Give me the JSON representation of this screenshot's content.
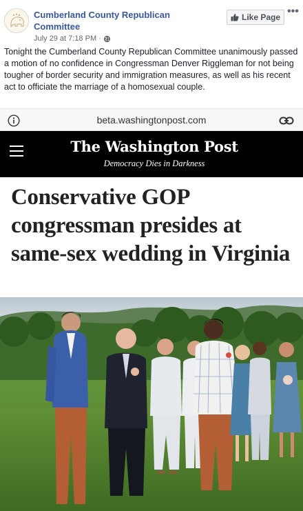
{
  "post": {
    "page_name": "Cumberland County Republican Committee",
    "timestamp": "July 29 at 7:18 PM",
    "separator": "·",
    "privacy_icon": "globe-icon",
    "like_page_label": "Like Page",
    "like_icon": "thumbs-up-icon",
    "more_label": "•••",
    "text": "Tonight the Cumberland County Republican Committee unanimously passed a motion of no confidence in Congressman Denver Riggleman for not being tougher of border security and immigration measures, as well as his recent act to officiate the marriage of a homosexual couple."
  },
  "link_preview": {
    "url": "beta.washingtonpost.com",
    "info_icon": "info-icon",
    "link_icon": "link-icon",
    "masthead": "The Washington Post",
    "tagline": "Democracy Dies in Darkness",
    "menu_icon": "hamburger-icon",
    "headline": "Conservative GOP congressman presides at same-sex wedding in Virginia",
    "photo": "outdoor-wedding-photo"
  },
  "colors": {
    "facebook_link": "#385898",
    "wapo_banner": "#000000",
    "grass": "#4f7a2f"
  }
}
